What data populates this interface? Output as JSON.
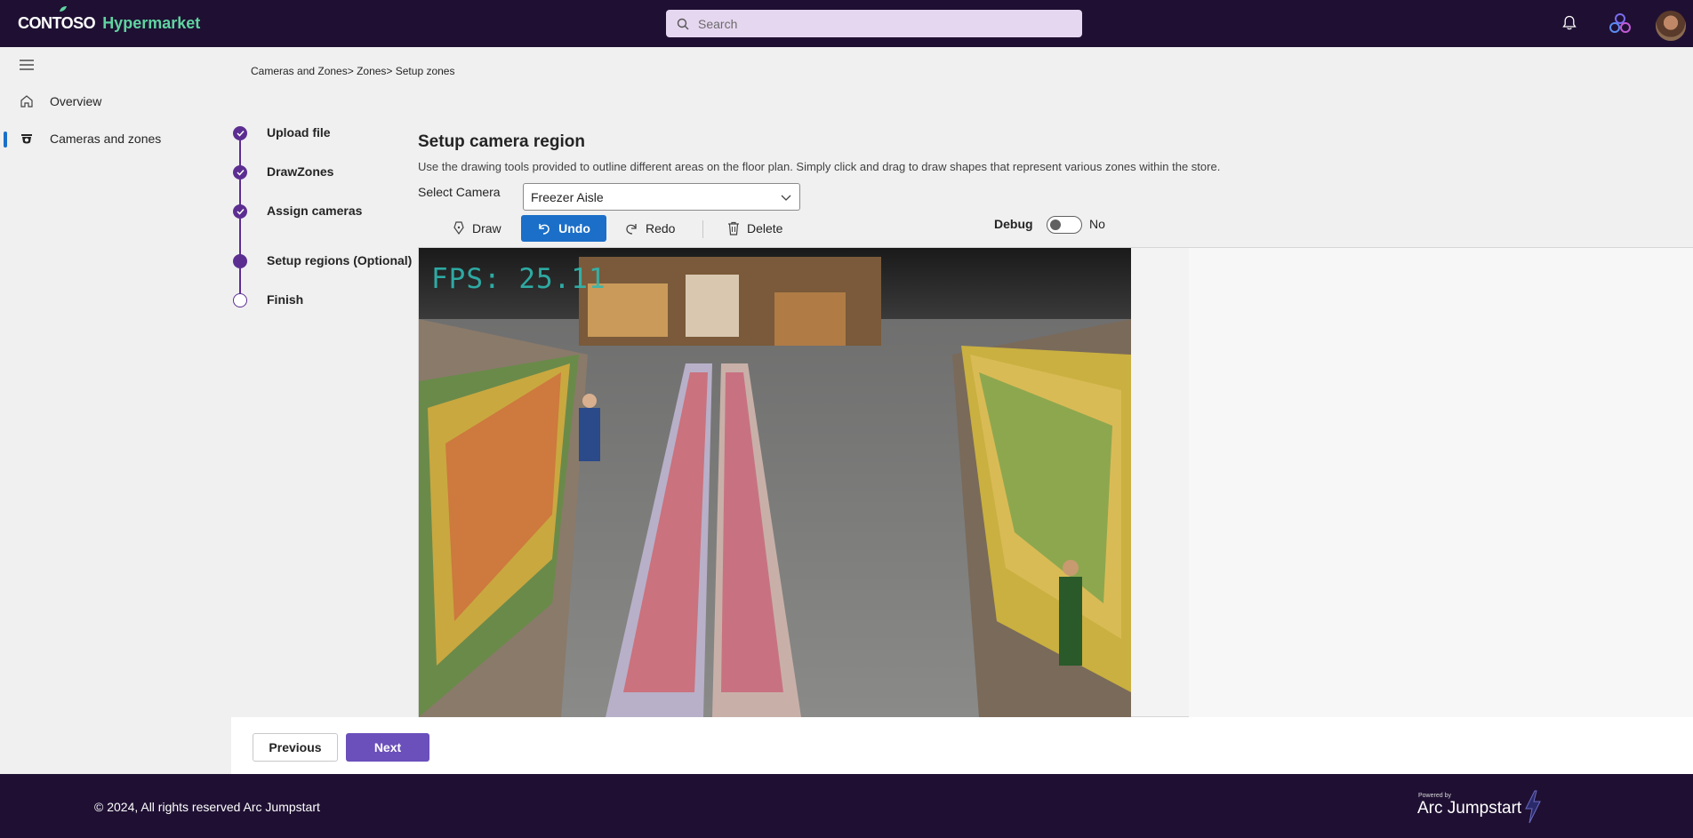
{
  "header": {
    "brand_primary": "CONTOSO",
    "brand_secondary": "Hypermarket",
    "search_placeholder": "Search"
  },
  "sidebar": {
    "items": [
      {
        "label": "Overview",
        "icon": "home-icon",
        "active": false
      },
      {
        "label": "Cameras and zones",
        "icon": "camera-icon",
        "active": true
      }
    ]
  },
  "breadcrumb": "Cameras and Zones> Zones> Setup zones",
  "stepper": {
    "steps": [
      {
        "label": "Upload file",
        "state": "done"
      },
      {
        "label": "DrawZones",
        "state": "done"
      },
      {
        "label": "Assign cameras",
        "state": "done"
      },
      {
        "label": "Setup regions (Optional)",
        "state": "current"
      },
      {
        "label": "Finish",
        "state": "pending"
      }
    ]
  },
  "main": {
    "title": "Setup camera region",
    "description": "Use the drawing tools provided to outline different areas on the floor plan. Simply click and drag to draw shapes that represent various zones within the store.",
    "select_label": "Select Camera",
    "select_value": "Freezer Aisle",
    "toolbar": {
      "draw": "Draw",
      "undo": "Undo",
      "redo": "Redo",
      "delete": "Delete"
    },
    "debug_label": "Debug",
    "debug_value": "No",
    "video_overlay": "FPS: 25.11"
  },
  "actions": {
    "previous": "Previous",
    "next": "Next"
  },
  "footer": {
    "copyright": "© 2024, All rights reserved Arc Jumpstart",
    "powered_by": "Powered by",
    "brand": "Arc Jumpstart"
  },
  "colors": {
    "topbar_bg": "#1f1033",
    "brand_accent": "#5fd4a0",
    "step_purple": "#5c2e91",
    "undo_blue": "#1b6fc8",
    "next_purple": "#6b4fbb"
  }
}
